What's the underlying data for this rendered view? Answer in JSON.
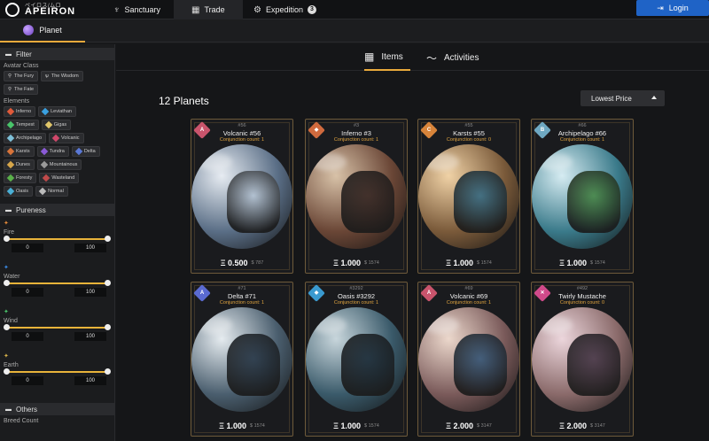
{
  "brand": {
    "kana": "ペイロス/ムロ",
    "name": "APEIRON"
  },
  "nav": {
    "sanctuary": "Sanctuary",
    "trade": "Trade",
    "expedition": "Expedition",
    "expedition_badge": "3",
    "login": "Login"
  },
  "subnav": {
    "planet": "Planet"
  },
  "filter": {
    "title": "Filter",
    "avatar_class_label": "Avatar Class",
    "avatar_classes": [
      "The Fury",
      "The Wisdom",
      "The Fate"
    ],
    "elements_label": "Elements",
    "elements": [
      {
        "name": "Inferno",
        "color": "#e05a3a"
      },
      {
        "name": "Leviathan",
        "color": "#3aa0e0"
      },
      {
        "name": "Tempest",
        "color": "#49c46a"
      },
      {
        "name": "Gigas",
        "color": "#e0c66a"
      },
      {
        "name": "Archipelago",
        "color": "#7ec0d8"
      },
      {
        "name": "Volcanic",
        "color": "#d0486a"
      },
      {
        "name": "Karsts",
        "color": "#d8743a"
      },
      {
        "name": "Tundra",
        "color": "#8a5ad6"
      },
      {
        "name": "Delta",
        "color": "#5a78d6"
      },
      {
        "name": "Dunes",
        "color": "#d6a64a"
      },
      {
        "name": "Mountainous",
        "color": "#9a9a9a"
      },
      {
        "name": "Foresty",
        "color": "#5ab04a"
      },
      {
        "name": "Wasteland",
        "color": "#c04a4a"
      },
      {
        "name": "Oasis",
        "color": "#4ab0d6"
      },
      {
        "name": "Normal",
        "color": "#bbbbbb"
      }
    ]
  },
  "pureness": {
    "title": "Pureness",
    "ranges": [
      {
        "name": "Fire",
        "min": "0",
        "max": "100",
        "color": "#e58a3a"
      },
      {
        "name": "Water",
        "min": "0",
        "max": "100",
        "color": "#3a8ae5"
      },
      {
        "name": "Wind",
        "min": "0",
        "max": "100",
        "color": "#4ac46a"
      },
      {
        "name": "Earth",
        "min": "0",
        "max": "100",
        "color": "#d6b24a"
      }
    ]
  },
  "others": {
    "title": "Others",
    "breed_count": "Breed Count"
  },
  "tabs": {
    "items": "Items",
    "activities": "Activities"
  },
  "listing": {
    "heading": "12 Planets",
    "sort": "Lowest Price"
  },
  "cards": [
    {
      "id": "#56",
      "name": "Volcanic #56",
      "conj": "Conjunction count: 1",
      "price": "Ξ 0.500",
      "usd": "$ 787",
      "gem": "#c9546c",
      "gem_letter": "A",
      "orb": [
        "#e7ecf2",
        "#5a6e86",
        "#b7c6d6"
      ]
    },
    {
      "id": "#3",
      "name": "Inferno #3",
      "conj": "Conjunction count: 1",
      "price": "Ξ 1.000",
      "usd": "$ 1574",
      "gem": "#d06a3e",
      "gem_letter": "◆",
      "orb": [
        "#d8c2a8",
        "#6a4636",
        "#3a2a26"
      ]
    },
    {
      "id": "#55",
      "name": "Karsts #55",
      "conj": "Conjunction count: 0",
      "price": "Ξ 1.000",
      "usd": "$ 1574",
      "gem": "#d8843a",
      "gem_letter": "C",
      "orb": [
        "#f0d2a6",
        "#7a5a3a",
        "#3a6e86"
      ]
    },
    {
      "id": "#66",
      "name": "Archipelago #66",
      "conj": "Conjunction count: 1",
      "price": "Ξ 1.000",
      "usd": "$ 1574",
      "gem": "#6ea8c2",
      "gem_letter": "B",
      "orb": [
        "#d6ecf2",
        "#3a7a8a",
        "#4a8a4a"
      ]
    },
    {
      "id": "#71",
      "name": "Delta #71",
      "conj": "Conjunction count: 1",
      "price": "Ξ 1.000",
      "usd": "$ 1574",
      "gem": "#5a6ad0",
      "gem_letter": "A",
      "orb": [
        "#e6ecf0",
        "#4a5e6e",
        "#2a3a4a"
      ]
    },
    {
      "id": "#3292",
      "name": "Oasis #3292",
      "conj": "Conjunction count: 1",
      "price": "Ξ 1.000",
      "usd": "$ 1574",
      "gem": "#3a9ad0",
      "gem_letter": "◆",
      "orb": [
        "#c8d6dc",
        "#3a5a6a",
        "#1e2e3a"
      ]
    },
    {
      "id": "#69",
      "name": "Volcanic #69",
      "conj": "Conjunction count: 1",
      "price": "Ξ 2.000",
      "usd": "$ 3147",
      "gem": "#c9546c",
      "gem_letter": "A",
      "orb": [
        "#ecd8cc",
        "#7a5a5a",
        "#3a5a7a"
      ]
    },
    {
      "id": "#492",
      "name": "Twirly Mustache",
      "conj": "Conjunction count: 0",
      "price": "Ξ 2.000",
      "usd": "$ 3147",
      "gem": "#d04a8a",
      "gem_letter": "✕",
      "orb": [
        "#ecd6dc",
        "#8a6a6a",
        "#4a3a4a"
      ]
    }
  ]
}
